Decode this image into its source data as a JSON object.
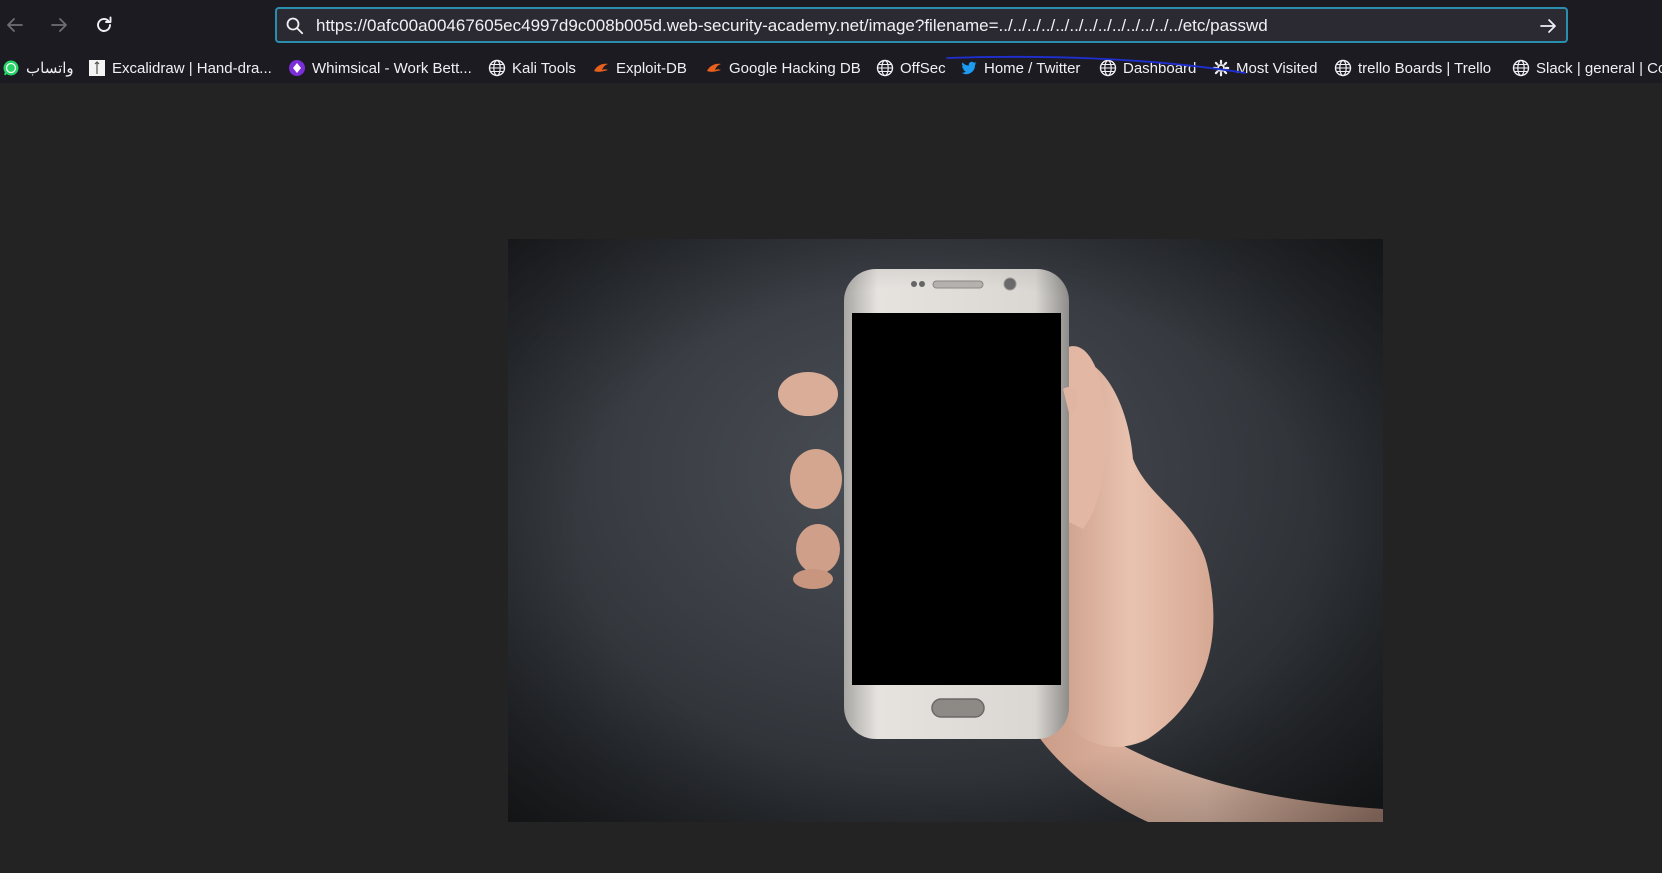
{
  "toolbar": {
    "back_icon": "back-arrow-icon",
    "forward_icon": "forward-arrow-icon",
    "reload_icon": "reload-icon"
  },
  "urlbar": {
    "url": "https://0afc00a00467605ec4997d9c008b005d.web-security-academy.net/image?filename=../../../../../../../../../../../../../etc/passwd",
    "search_icon": "search-icon",
    "go_icon": "go-arrow-icon",
    "border_color": "#2a8fae"
  },
  "bookmarks": [
    {
      "label": "واتساب",
      "icon": "whatsapp-icon"
    },
    {
      "label": "Excalidraw | Hand-dra...",
      "icon": "excalidraw-icon"
    },
    {
      "label": "Whimsical - Work Bett...",
      "icon": "whimsical-icon"
    },
    {
      "label": "Kali Tools",
      "icon": "globe-icon"
    },
    {
      "label": "Exploit-DB",
      "icon": "exploit-db-icon"
    },
    {
      "label": "Google Hacking DB",
      "icon": "exploit-db-icon"
    },
    {
      "label": "OffSec",
      "icon": "globe-icon"
    },
    {
      "label": "Home / Twitter",
      "icon": "twitter-icon"
    },
    {
      "label": "Dashboard",
      "icon": "globe-icon"
    },
    {
      "label": "Most Visited",
      "icon": "gear-icon"
    },
    {
      "label": "trello  Boards | Trello",
      "icon": "globe-icon"
    },
    {
      "label": "Slack | general | Co",
      "icon": "globe-icon"
    }
  ],
  "page": {
    "image_subject": "hand holding white smartphone with black screen",
    "background_color": "#232323"
  }
}
